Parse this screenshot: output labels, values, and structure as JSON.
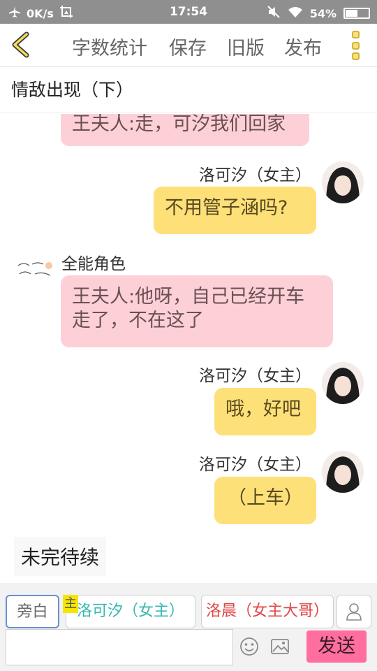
{
  "status_bar": {
    "net_speed": "0K/s",
    "time": "17:54",
    "battery_percent": "54%",
    "battery_level": 0.54
  },
  "toolbar": {
    "word_count": "字数统计",
    "save": "保存",
    "old_version": "旧版",
    "publish": "发布"
  },
  "story": {
    "title": "情敌出现（下）"
  },
  "messages": [
    {
      "type": "pink",
      "text": "王夫人:走，可汐我们回家"
    },
    {
      "type": "right",
      "speaker": "洛可汐（女主）",
      "text": "不用管子涵吗?"
    },
    {
      "type": "left",
      "speaker": "全能角色",
      "text_line1": "王夫人:他呀，自己已经开车",
      "text_line2": "走了，不在这了"
    },
    {
      "type": "right",
      "speaker": "洛可汐（女主）",
      "text": "哦，好吧"
    },
    {
      "type": "right",
      "speaker": "洛可汐（女主）",
      "text": "（上车）"
    },
    {
      "type": "narration",
      "text": "未完待续"
    }
  ],
  "bottom": {
    "narration_chip": "旁白",
    "main_tag": "主",
    "char1_chip": "洛可汐（女主）",
    "char2_chip": "洛晨（女主大哥）",
    "send": "发送",
    "input_value": ""
  },
  "colors": {
    "pink_bubble": "#fdd0d8",
    "yellow_bubble": "#fee079",
    "send_button": "#ff6e9f",
    "char1_text": "#36b7b1",
    "char2_text": "#e04646"
  },
  "icons": [
    "airplane-icon",
    "screenshot-icon",
    "mute-icon",
    "wifi-icon",
    "battery-icon",
    "back-chevron-icon",
    "more-icon",
    "user-icon",
    "emoji-icon",
    "image-icon"
  ]
}
